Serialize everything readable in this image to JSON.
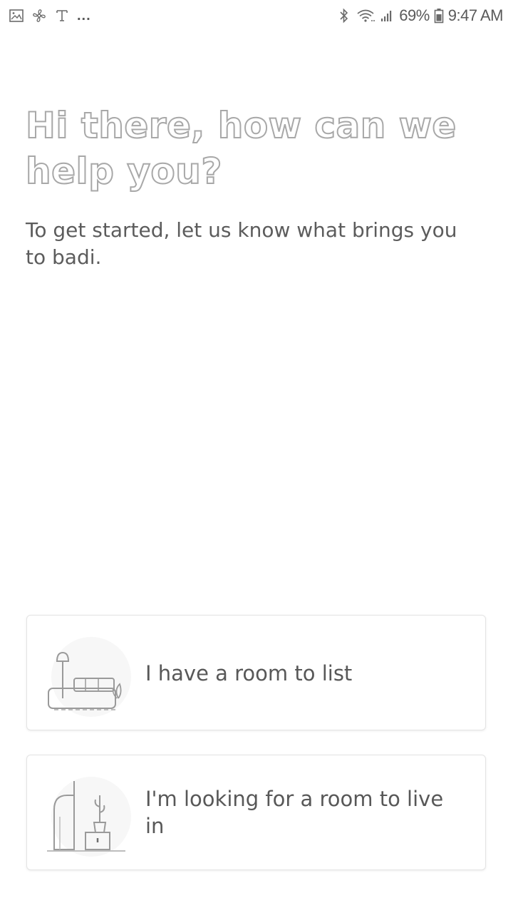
{
  "status_bar": {
    "left_icons": [
      "gallery-icon",
      "fan-icon",
      "t-icon"
    ],
    "more": "...",
    "battery_percent": "69%",
    "time": "9:47 AM",
    "right_icons": [
      "bluetooth-icon",
      "wifi-icon",
      "signal-icon",
      "battery-icon"
    ]
  },
  "heading": "Hi there, how can we help you?",
  "subtitle": "To get started, let us know what brings you to badi.",
  "options": [
    {
      "label": "I have a room to list",
      "icon": "room-listing-illustration"
    },
    {
      "label": "I'm looking for a room to live in",
      "icon": "room-seeker-illustration"
    }
  ],
  "colors": {
    "heading_stroke": "#a8a8a8",
    "text": "#585858",
    "card_border": "#e4e4e4"
  }
}
